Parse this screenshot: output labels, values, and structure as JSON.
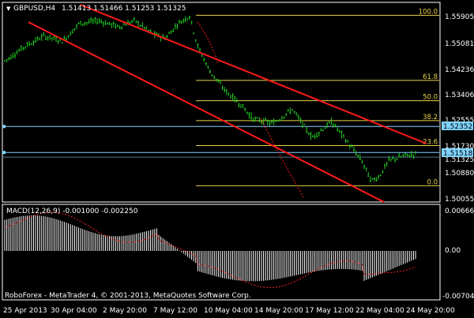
{
  "header": {
    "symbol_tf": "GBPUSD,H4",
    "quote": "1.51413 1.51466 1.51253 1.51325",
    "direction_marker": "▼"
  },
  "fib_levels": [
    {
      "label": "100.0",
      "price": 1.5592
    },
    {
      "label": "61.8",
      "price": 1.5383
    },
    {
      "label": "50.0",
      "price": 1.5318
    },
    {
      "label": "38.2",
      "price": 1.5254
    },
    {
      "label": "23.6",
      "price": 1.5174
    },
    {
      "label": "0.0",
      "price": 1.5045
    }
  ],
  "price_axis": [
    "1.55905",
    "1.55081",
    "1.54236",
    "1.53406",
    "1.52555",
    "1.51730",
    "1.51325",
    "1.50880",
    "1.50055"
  ],
  "price_marks": [
    {
      "label": "1.52352",
      "price": 1.52352,
      "color": "#7fd4ff"
    },
    {
      "label": "1.51518",
      "price": 1.51518,
      "color": "#7fd4ff"
    }
  ],
  "macd": {
    "label": "MACD(12,26,9) -0.001000 -0.002250",
    "axis": [
      "0.006665",
      "0.00",
      "-0.007049"
    ]
  },
  "time_axis": [
    "25 Apr 2013",
    "30 Apr 04:00",
    "2 May 20:00",
    "7 May 12:00",
    "10 May 04:00",
    "14 May 20:00",
    "17 May 12:00",
    "22 May 04:00",
    "24 May 20:00"
  ],
  "footer": "RoboForex - MetaTrader 4, © 2001-2013, MetaQuotes Software Corp.",
  "colors": {
    "candle": "#22cc22",
    "channel": "#ff1a1a",
    "fib": "#e6d24a",
    "hline": "#7fd4ff",
    "macd_hist": "#ffffff",
    "macd_signal": "#ff2020",
    "grid_border": "#ffffff"
  }
}
